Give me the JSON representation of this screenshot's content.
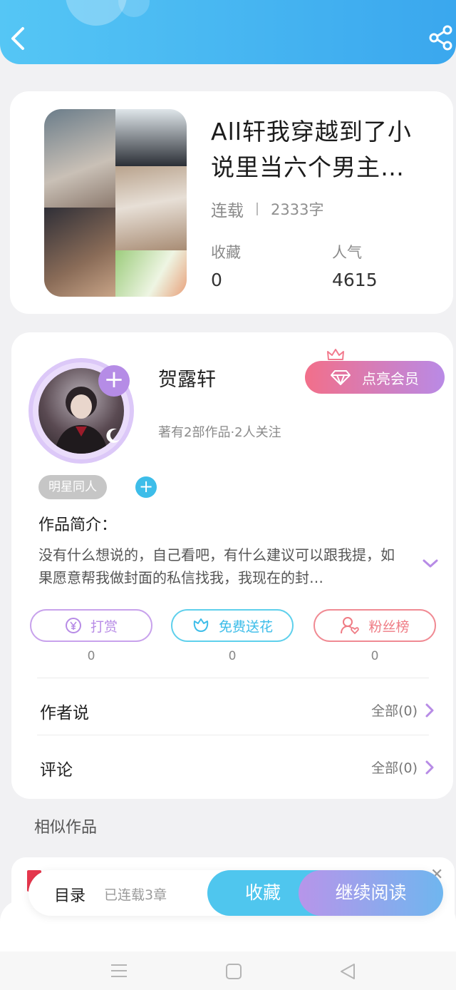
{
  "header": {
    "back_icon": "chevron-left-icon",
    "share_icon": "share-icon",
    "color_start": "#55c6f5",
    "color_end": "#3aa7ee"
  },
  "book": {
    "title": "All轩我穿越到了小说里当六个男主…",
    "status": "连载",
    "word_count": "2333字",
    "favorites_label": "收藏",
    "favorites_value": "0",
    "popularity_label": "人气",
    "popularity_value": "4615"
  },
  "author": {
    "name": "贺露轩",
    "summary": "著有2部作品·2人关注",
    "vip_label": "点亮会员",
    "tag": "明星同人",
    "intro_label": "作品简介：",
    "intro_text": "没有什么想说的，自己看吧，有什么建议可以跟我提，如果愿意帮我做封面的私信找我，我现在的封…"
  },
  "actions": [
    {
      "label": "打赏",
      "count": "0",
      "icon": "yen-coin-icon"
    },
    {
      "label": "免费送花",
      "count": "0",
      "icon": "flower-icon"
    },
    {
      "label": "粉丝榜",
      "count": "0",
      "icon": "fans-user-icon"
    }
  ],
  "rows": [
    {
      "title": "作者说",
      "link": "全部(0)"
    },
    {
      "title": "评论",
      "link": "全部(0)"
    }
  ],
  "similar_label": "相似作品",
  "bottom_bar": {
    "toc_label": "目录",
    "toc_sub": "已连载3章",
    "fav_label": "收藏",
    "read_label": "继续阅读"
  },
  "nav": {
    "menu_icon": "menu-icon",
    "home_icon": "square-home-icon",
    "back_icon": "triangle-back-icon"
  }
}
